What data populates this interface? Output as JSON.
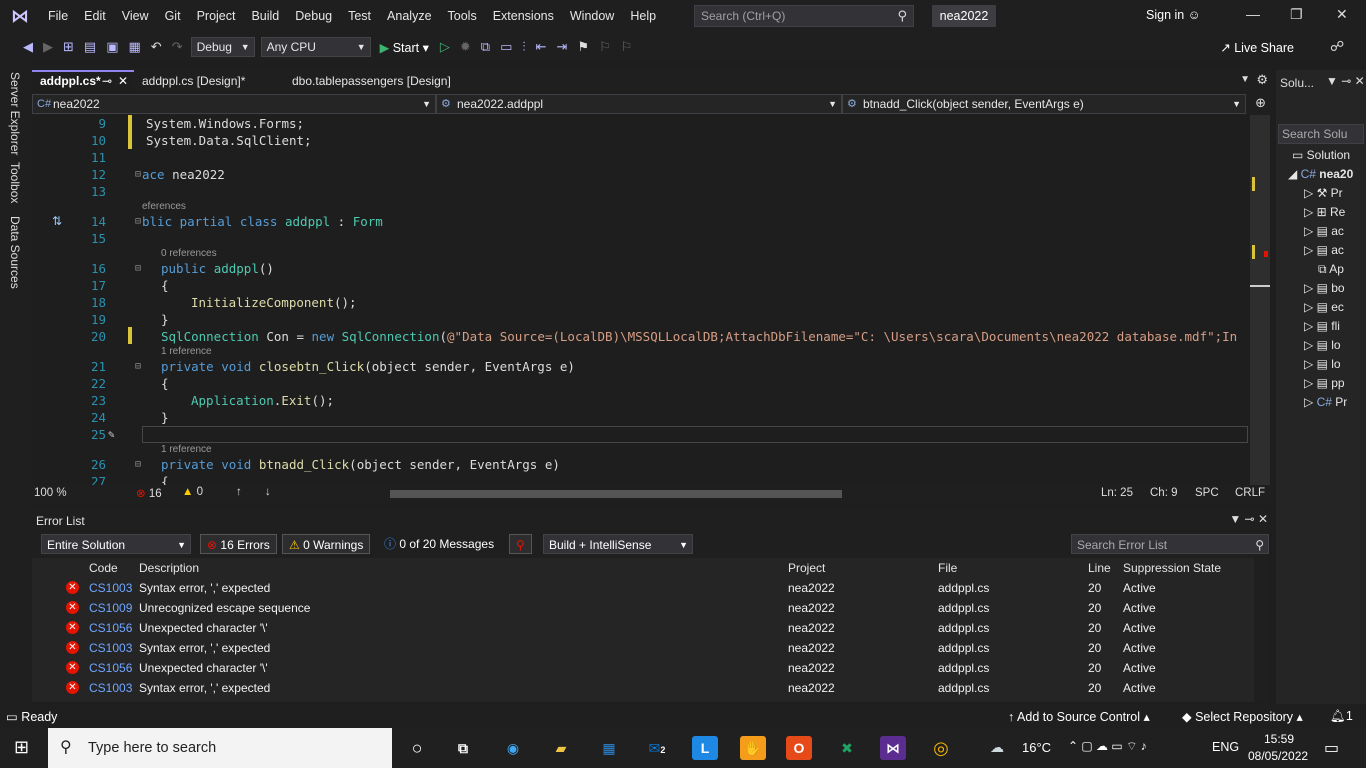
{
  "menu": {
    "items": [
      "File",
      "Edit",
      "View",
      "Git",
      "Project",
      "Build",
      "Debug",
      "Test",
      "Analyze",
      "Tools",
      "Extensions",
      "Window",
      "Help"
    ],
    "search_placeholder": "Search (Ctrl+Q)",
    "solution_name": "nea2022",
    "sign_in": "Sign in"
  },
  "toolbar": {
    "config": "Debug",
    "platform": "Any CPU",
    "start": "Start",
    "live_share": "Live Share"
  },
  "left_tabs": [
    "Server Explorer",
    "Toolbox",
    "Data Sources"
  ],
  "doc_tabs": [
    "addppl.cs*",
    "addppl.cs [Design]*",
    "dbo.tablepassengers [Design]"
  ],
  "nav": {
    "project": "nea2022",
    "class": "nea2022.addppl",
    "member": "btnadd_Click(object sender, EventArgs e)"
  },
  "code": {
    "l9": "System.Windows.Forms;",
    "l10": "System.Data.SqlClient;",
    "l12_kw": "ace",
    "l12_name": "nea2022",
    "l14_refs": "eferences",
    "l14_kw": "blic partial class",
    "l14_name": "addppl",
    "l14_base": "Form",
    "l16_refs": "0 references",
    "l16_kw": "public",
    "l16_name": "addppl",
    "l18": "InitializeComponent",
    "l20_type": "SqlConnection",
    "l20_var": "Con",
    "l20_new": "new",
    "l20_str": "@\"Data Source=(LocalDB)\\MSSQLLocalDB;AttachDbFilename=\"C: \\Users\\scara\\Documents\\nea2022 database.mdf\";In",
    "l21_refs": "1 reference",
    "l21_kw": "private void",
    "l21_name": "closebtn_Click",
    "l21_params": "object sender, EventArgs e",
    "l23_cls": "Application",
    "l23_mt": "Exit",
    "l26_refs": "1 reference",
    "l26_kw": "private void",
    "l26_name": "btnadd_Click",
    "l26_params": "object sender, EventArgs e"
  },
  "line_numbers": [
    "9",
    "10",
    "11",
    "12",
    "13",
    "14",
    "15",
    "16",
    "17",
    "18",
    "19",
    "20",
    "21",
    "22",
    "23",
    "24",
    "25",
    "26",
    "27"
  ],
  "editor_status": {
    "zoom": "100 %",
    "errors": "16",
    "warnings": "0",
    "line": "Ln: 25",
    "ch": "Ch: 9",
    "spc": "SPC",
    "crlf": "CRLF"
  },
  "error_list": {
    "title": "Error List",
    "scope": "Entire Solution",
    "errors_btn": "16 Errors",
    "warnings_btn": "0 Warnings",
    "messages_btn": "0 of 20 Messages",
    "build_filter": "Build + IntelliSense",
    "search_placeholder": "Search Error List",
    "headers": {
      "code": "Code",
      "description": "Description",
      "project": "Project",
      "file": "File",
      "line": "Line",
      "state": "Suppression State"
    },
    "rows": [
      {
        "code": "CS1003",
        "description": "Syntax error, ',' expected",
        "project": "nea2022",
        "file": "addppl.cs",
        "line": "20",
        "state": "Active"
      },
      {
        "code": "CS1009",
        "description": "Unrecognized escape sequence",
        "project": "nea2022",
        "file": "addppl.cs",
        "line": "20",
        "state": "Active"
      },
      {
        "code": "CS1056",
        "description": "Unexpected character '\\'",
        "project": "nea2022",
        "file": "addppl.cs",
        "line": "20",
        "state": "Active"
      },
      {
        "code": "CS1003",
        "description": "Syntax error, ',' expected",
        "project": "nea2022",
        "file": "addppl.cs",
        "line": "20",
        "state": "Active"
      },
      {
        "code": "CS1056",
        "description": "Unexpected character '\\'",
        "project": "nea2022",
        "file": "addppl.cs",
        "line": "20",
        "state": "Active"
      },
      {
        "code": "CS1003",
        "description": "Syntax error, ',' expected",
        "project": "nea2022",
        "file": "addppl.cs",
        "line": "20",
        "state": "Active"
      }
    ]
  },
  "solution_explorer": {
    "title": "Solu...",
    "search": "Search Solu",
    "items": [
      "Solution",
      "nea20",
      "Pr",
      "Re",
      "ac",
      "ac",
      "Ap",
      "bo",
      "ec",
      "fli",
      "lo",
      "lo",
      "pp",
      "Pr"
    ]
  },
  "status": {
    "ready": "Ready",
    "source_control": "Add to Source Control",
    "repository": "Select Repository",
    "notif": "1"
  },
  "taskbar": {
    "search": "Type here to search",
    "temp": "16°C",
    "lang": "ENG",
    "time": "15:59",
    "date": "08/05/2022",
    "mail_badge": "2"
  },
  "colors": {
    "accent": "#9184ee",
    "error": "#e51400",
    "keyword": "#569cd6",
    "type": "#4ec9b0",
    "string": "#d69d85"
  }
}
